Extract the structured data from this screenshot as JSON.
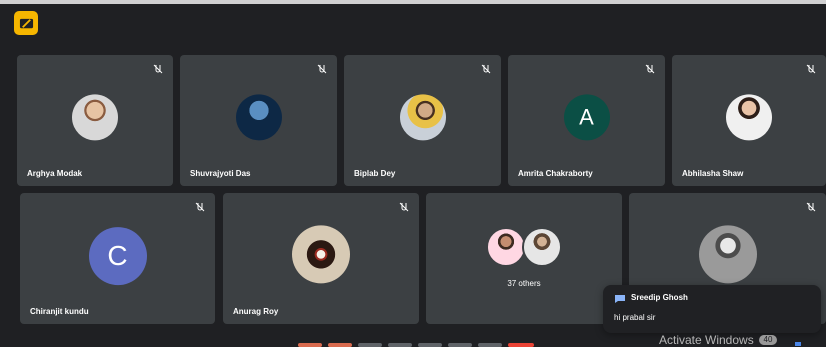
{
  "meeting": {
    "participants": [
      {
        "name": "Arghya Modak",
        "avatar": "photo"
      },
      {
        "name": "Shuvrajyoti Das",
        "avatar": "logo-photo"
      },
      {
        "name": "Biplab Dey",
        "avatar": "photo"
      },
      {
        "name": "Amrita Chakraborty",
        "avatar_letter": "A",
        "avatar_color": "#0b4f45"
      },
      {
        "name": "Abhilasha Shaw",
        "avatar": "photo"
      },
      {
        "name": "Chiranjit kundu",
        "avatar_letter": "C",
        "avatar_color": "#5c6bc0"
      },
      {
        "name": "Anurag Roy",
        "avatar": "photo"
      },
      {
        "name": "",
        "others_label": "37 others"
      },
      {
        "name": "",
        "avatar": "photo"
      }
    ]
  },
  "chat": {
    "sender": "Sreedip Ghosh",
    "message": "hi prabal sir"
  },
  "system": {
    "watermark": "Activate Windows",
    "badge": "40"
  },
  "colors": {
    "background": "#202124",
    "tile": "#3c4043",
    "accent": "#f6b600"
  },
  "icons": {
    "app": "present-icon",
    "mic": "mic-off-icon",
    "chat": "chat-icon"
  }
}
